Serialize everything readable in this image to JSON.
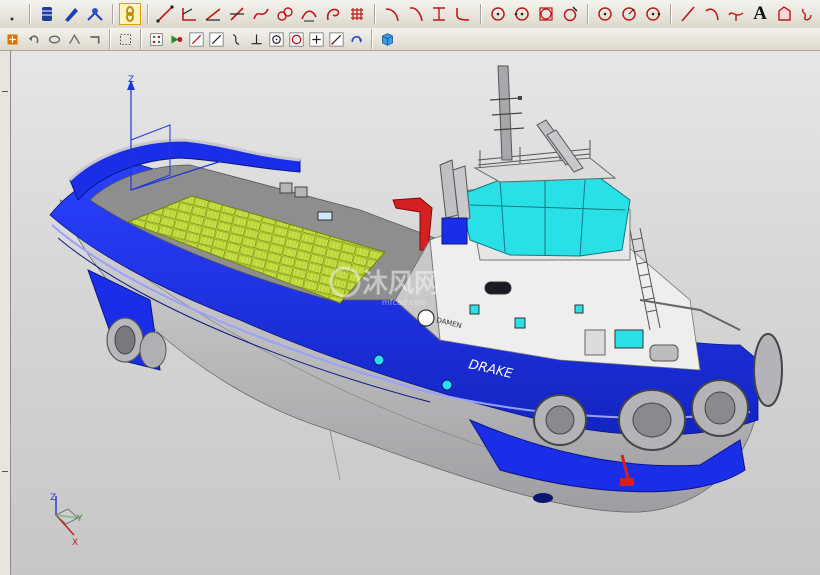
{
  "toolbar_primary": {
    "text_tool_label": "A",
    "icons": [
      "point-icon",
      "layer-icon",
      "pencil-icon",
      "snap-icon",
      "link-icon",
      "line-icon",
      "angle-icon",
      "line-angle-icon",
      "cross-line-icon",
      "spline-icon",
      "chain-icon",
      "curve-offset-icon",
      "arc-spiral-icon",
      "grid-icon",
      "bend-icon",
      "bend-alt-icon",
      "trim-icon",
      "fillet-icon",
      "circle-center-icon",
      "circle-pt-icon",
      "circle-square-icon",
      "circle-tangent-icon",
      "circle-3pt-icon",
      "circle-radius-icon",
      "circle-dot-icon",
      "line-diagonal-icon",
      "arc-icon",
      "branch-icon",
      "text-icon",
      "region-icon",
      "link2-icon"
    ]
  },
  "toolbar_secondary": {
    "icons": [
      "view-menu-icon",
      "undo-icon",
      "rotate-icon",
      "fit-icon",
      "grab-icon",
      "select-box-icon",
      "snap-grid-icon",
      "selection-filter-icon",
      "line-select-icon",
      "slash-icon",
      "curve-icon",
      "perpendicular-icon",
      "circle-select-icon",
      "ring-select-icon",
      "plus-select-icon",
      "diagonal-select-icon",
      "refresh-icon",
      "cube-icon"
    ]
  },
  "viewport": {
    "vessel_name": "DRAKE",
    "house_label": "DAMEN",
    "axes": {
      "z": "Z",
      "y": "Y",
      "x": "X"
    },
    "colors": {
      "hull_blue": "#1a2ee8",
      "hull_grey": "#c4c4c6",
      "deck_grey": "#8e8e8e",
      "wheelhouse_cyan": "#28e0e6",
      "grating_yellow": "#c9e044",
      "superstructure_white": "#eeeeee",
      "crane_red": "#d42020"
    }
  },
  "watermark": {
    "text": "沐风网",
    "sub": "mfcad.com"
  }
}
